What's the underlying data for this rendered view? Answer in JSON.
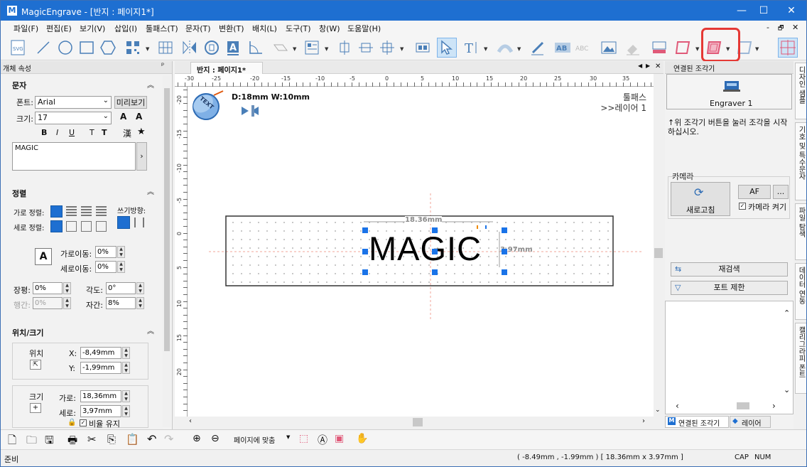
{
  "window": {
    "title": "MagicEngrave - [반지 : 페이지1*]",
    "app_icon": "M",
    "min": "—",
    "max": "☐",
    "close": "✕"
  },
  "menu": [
    "파일(F)",
    "편집(E)",
    "보기(V)",
    "삽입(I)",
    "툴패스(T)",
    "문자(T)",
    "변환(T)",
    "배치(L)",
    "도구(T)",
    "창(W)",
    "도움말(H)"
  ],
  "menu_right": {
    "min": "-",
    "restore": "🗗",
    "close": "✕"
  },
  "toolbar": {
    "svg_label": "SVG",
    "text_label": "T",
    "ab_label": "AB",
    "abc_label": "ABC"
  },
  "left_panel": {
    "title": "개체 속성",
    "pin": "ᵖ",
    "text_section": {
      "header": "문자",
      "font_label": "폰트:",
      "font_value": "Arial",
      "preview_button": "미리보기",
      "size_label": "크기:",
      "size_value": "17",
      "size_up": "A",
      "size_down": "A",
      "bold": "B",
      "italic": "I",
      "underline": "U",
      "t1": "T",
      "t2": "T",
      "hanja": "漢",
      "star": "★",
      "text_value": "MAGIC"
    },
    "align_section": {
      "header": "정렬",
      "h_align": "가로 정렬:",
      "v_align": "세로 정렬:",
      "direction": "쓰기방향:",
      "h_move": "가로이동:",
      "h_move_val": "0%",
      "v_move": "세로이동:",
      "v_move_val": "0%",
      "width_label": "장평:",
      "width_val": "0%",
      "angle_label": "각도:",
      "angle_val": "0°",
      "line_label": "행간:",
      "line_val": "0%",
      "char_label": "자간:",
      "char_val": "8%"
    },
    "pos_section": {
      "header": "위치/크기",
      "pos_label": "위치",
      "x_label": "X:",
      "x_val": "-8,49mm",
      "y_label": "Y:",
      "y_val": "-1,99mm",
      "size_label": "크기",
      "w_label": "가로:",
      "w_val": "18,36mm",
      "h_label": "세로:",
      "h_val": "3,97mm",
      "ratio_label": "비율 유지"
    }
  },
  "document": {
    "tab": "반지 : 페이지1*",
    "nav_left": "◀",
    "nav_right": "▶",
    "close": "✕",
    "tool_info": "D:18mm  W:10mm",
    "toolpath": "툴패스",
    "layer": ">>레이어 1",
    "ring_text": "MAGIC",
    "dim_w": "18.36mm",
    "dim_h": "3.97mm",
    "badge": "TEXT",
    "ruler_h": [
      "-30",
      "-25",
      "-20",
      "-15",
      "-10",
      "-5",
      "0",
      "5",
      "10",
      "15",
      "20",
      "25",
      "30",
      "35"
    ],
    "ruler_v": [
      "-20",
      "-15",
      "-10",
      "-5",
      "0",
      "5",
      "10",
      "15",
      "20"
    ]
  },
  "right_panel": {
    "title": "연결된 조각기",
    "engraver": "Engraver 1",
    "hint": "↑위 조각기 버튼을 눌러 조각을 시작하십시오.",
    "camera_header": "카메라",
    "refresh": "새로고침",
    "af": "AF",
    "more": "...",
    "camera_on": "카메라 켜기",
    "rescan": "재검색",
    "port_limit": "포트 제한",
    "tab_engraver": "연결된 조각기",
    "tab_layer": "레이어"
  },
  "side_tabs": [
    "디자인 샘플",
    "기호 및 특수문자",
    "파일 탐색",
    "데이터 연동",
    "캘리그라피 폰트"
  ],
  "bottom_toolbar": {
    "fit": "페이지에 맞춤"
  },
  "status": {
    "ready": "준비",
    "coords": "( -8.49mm , -1.99mm )  [ 18.36mm x 3.97mm ]",
    "cap": "CAP",
    "num": "NUM"
  },
  "colors": {
    "titlebar": "#1e6fd1",
    "accent": "#1e6fd1",
    "highlight": "#e53935",
    "handle": "#1a73e8"
  }
}
